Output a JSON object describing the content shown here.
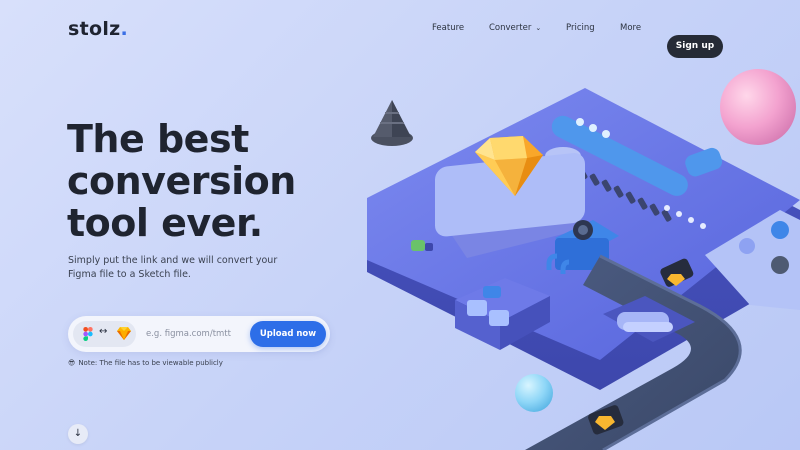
{
  "brand": {
    "name": "stolz",
    "accent": "."
  },
  "nav": {
    "items": [
      {
        "label": "Feature"
      },
      {
        "label": "Converter",
        "has_dropdown": true
      },
      {
        "label": "Pricing"
      },
      {
        "label": "More"
      }
    ],
    "signup_label": "Sign up"
  },
  "hero": {
    "title_line1": "The best",
    "title_line2": "conversion",
    "title_line3": "tool ever.",
    "subtitle": "Simply put the link and we will convert your Figma file to a Sketch file."
  },
  "upload": {
    "from_icon": "figma-icon",
    "arrows": "↔",
    "to_icon": "sketch-icon",
    "placeholder": "e.g. figma.com/tmtt",
    "button_label": "Upload now"
  },
  "note": {
    "emoji": "😎",
    "text": "Note: The file has to be viewable publicly"
  },
  "scroll": {
    "icon": "arrow-down-icon",
    "glyph": "↓"
  },
  "colors": {
    "primary": "#2d6ee8",
    "dark": "#262b36",
    "background": "#c9d4f8",
    "machine": "#5b68e0"
  }
}
